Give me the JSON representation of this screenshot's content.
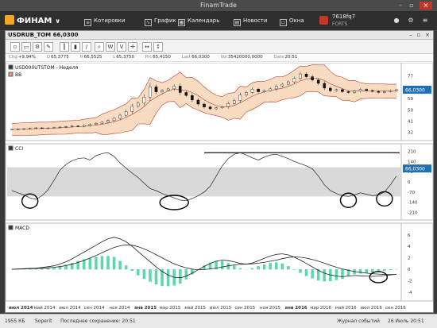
{
  "window": {
    "title": "FinamTrade"
  },
  "toolbar": {
    "brand": "ФИНАМ",
    "items": [
      {
        "label": "Котировки",
        "icon": "quotes-icon"
      },
      {
        "label": "График",
        "icon": "chart-icon"
      },
      {
        "label": "Календарь",
        "icon": "calendar-icon"
      },
      {
        "label": "Новости",
        "icon": "news-icon"
      },
      {
        "label": "Окна",
        "icon": "windows-icon"
      }
    ],
    "account": {
      "id": "7618fq7",
      "type": "FORTS"
    }
  },
  "chart_window": {
    "title": "USDRUB_TOM 66,0300",
    "quote": {
      "chg_label": "Chg",
      "chg": "+9,94%",
      "o_label": "O",
      "o": "65,3775",
      "h_label": "H",
      "h": "66,5525",
      "l_label": "L",
      "l": "65,3750",
      "prc_label": "Prc",
      "prc": "65,4150",
      "last_label": "Last",
      "last": "66,0300",
      "vol_label": "Vol",
      "vol": "35420000,0000",
      "date_label": "Date",
      "date": "20:51"
    }
  },
  "chart_data": [
    {
      "type": "candlestick",
      "legend": [
        "USD000UTSTOM - Неделя",
        "BB"
      ],
      "yticks": [
        77,
        68,
        59,
        50,
        41,
        32
      ],
      "ylim": [
        28,
        85
      ],
      "last_value": "66,0300",
      "months": [
        "июл 2014",
        "май 2014",
        "июл 2014",
        "сен 2014",
        "ноя 2014",
        "янв 2015",
        "мар 2015",
        "май 2015",
        "июл 2015",
        "сен 2015",
        "ноя 2015",
        "янв 2016",
        "мар 2016",
        "май 2016",
        "июл 2016",
        "сен 2016"
      ],
      "close": [
        34.4,
        34.6,
        34.9,
        35.2,
        35.6,
        35.3,
        35.5,
        35.8,
        36.2,
        36.7,
        37.1,
        36.8,
        37.5,
        38.4,
        39.3,
        40.1,
        41.5,
        43.2,
        45.7,
        48.6,
        52.9,
        55.3,
        60.1,
        68.4,
        64.2,
        65.6,
        66.7,
        68.9,
        63.8,
        61.4,
        57.8,
        54.6,
        52.3,
        50.8,
        51.6,
        52.4,
        55.1,
        57.4,
        61.8,
        63.9,
        66.5,
        64.4,
        65.3,
        66.7,
        68.9,
        70.4,
        72.3,
        75.1,
        78.6,
        76.4,
        73.8,
        71.1,
        67.3,
        65.2,
        66.1,
        64.5,
        63.8,
        64.9,
        66.3,
        65.4,
        64.7,
        63.9,
        64.6,
        65.3,
        66.03
      ]
    },
    {
      "type": "line",
      "name": "CCI",
      "legend": [
        "CCI"
      ],
      "yticks": [
        210,
        140,
        70,
        0,
        -70,
        -140,
        -210
      ],
      "ylim": [
        -240,
        240
      ],
      "last_value": "66,0300",
      "values": [
        -60,
        -75,
        -90,
        -110,
        -120,
        -95,
        -55,
        10,
        80,
        120,
        145,
        160,
        165,
        150,
        180,
        195,
        200,
        175,
        130,
        95,
        60,
        30,
        -10,
        -45,
        -60,
        -80,
        -95,
        -110,
        -125,
        -130,
        -115,
        -95,
        -70,
        -30,
        40,
        110,
        160,
        190,
        200,
        185,
        165,
        150,
        170,
        185,
        190,
        175,
        160,
        140,
        125,
        110,
        90,
        40,
        -20,
        -60,
        -80,
        -95,
        -100,
        -90,
        -75,
        -85,
        -95,
        -90,
        -70,
        -20,
        40
      ]
    },
    {
      "type": "line",
      "name": "MACD",
      "legend": [
        "MACD"
      ],
      "yticks": [
        6,
        4,
        2,
        0,
        -2,
        -4
      ],
      "ylim": [
        -5,
        7.5
      ],
      "macd": [
        0,
        0.05,
        0.1,
        0.15,
        0.2,
        0.3,
        0.45,
        0.6,
        0.9,
        1.3,
        1.8,
        2.4,
        3.0,
        3.6,
        4.2,
        4.8,
        5.3,
        5.6,
        5.3,
        4.8,
        4.0,
        3.1,
        2.2,
        1.3,
        0.4,
        -0.4,
        -1.0,
        -1.4,
        -1.5,
        -1.2,
        -0.7,
        -0.1,
        0.5,
        1.0,
        1.4,
        1.6,
        1.5,
        1.3,
        1.0,
        0.9,
        1.1,
        1.5,
        1.9,
        2.3,
        2.6,
        2.7,
        2.5,
        2.1,
        1.6,
        1.0,
        0.4,
        -0.2,
        -0.7,
        -1.0,
        -1.2,
        -1.3,
        -1.2,
        -1.1,
        -1.15,
        -1.2,
        -1.25,
        -1.2,
        -1.1,
        -1.0,
        -0.9
      ],
      "signal": [
        0,
        0.02,
        0.05,
        0.08,
        0.12,
        0.17,
        0.24,
        0.33,
        0.46,
        0.64,
        0.88,
        1.18,
        1.54,
        1.95,
        2.4,
        2.88,
        3.36,
        3.8,
        4.1,
        4.25,
        4.2,
        3.95,
        3.56,
        3.09,
        2.56,
        2.0,
        1.45,
        0.95,
        0.56,
        0.25,
        0.02,
        -0.08,
        -0.05,
        0.05,
        0.2,
        0.4,
        0.6,
        0.75,
        0.85,
        0.9,
        0.95,
        1.05,
        1.2,
        1.4,
        1.6,
        1.85,
        2.05,
        2.15,
        2.1,
        1.95,
        1.7,
        1.4,
        1.05,
        0.7,
        0.35,
        0.05,
        -0.2,
        -0.4,
        -0.55,
        -0.68,
        -0.78,
        -0.85,
        -0.9,
        -0.92,
        -0.92
      ]
    }
  ],
  "status": {
    "memory": "1955 КБ",
    "server": "Soperit",
    "saved": "Последнее сохранение: 20:51",
    "journal": "Журнал событий",
    "datetime": "26 Июль 20:51"
  },
  "colors": {
    "bb_fill": "#f8dcc2",
    "bb_line": "#c0392b",
    "hist": "#5ed6b0",
    "band": "#d9d9d9"
  }
}
